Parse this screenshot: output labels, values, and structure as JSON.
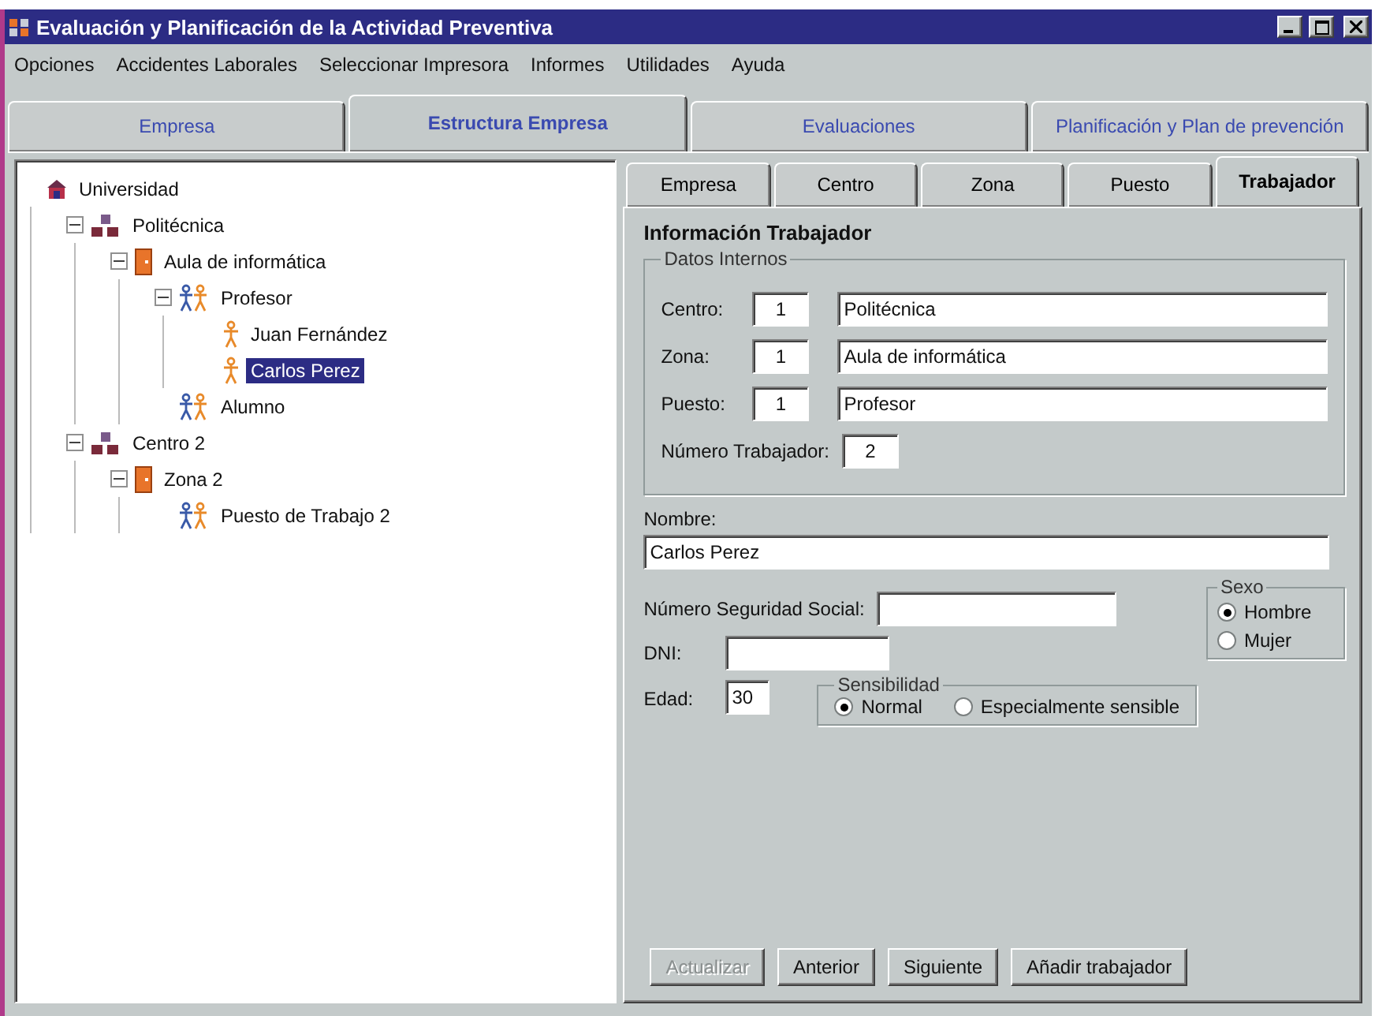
{
  "window": {
    "title": "Evaluación y Planificación de la Actividad Preventiva"
  },
  "menu": [
    "Opciones",
    "Accidentes Laborales",
    "Seleccionar Impresora",
    "Informes",
    "Utilidades",
    "Ayuda"
  ],
  "main_tabs": [
    {
      "label": "Empresa",
      "selected": false
    },
    {
      "label": "Estructura Empresa",
      "selected": true
    },
    {
      "label": "Evaluaciones",
      "selected": false
    },
    {
      "label": "Planificación y Plan de prevención",
      "selected": false
    }
  ],
  "tree": [
    {
      "label": "Universidad",
      "kind": "empresa",
      "selected": false,
      "children": [
        {
          "label": "Politécnica",
          "kind": "centro",
          "expanded": true,
          "selected": false,
          "children": [
            {
              "label": "Aula de informática",
              "kind": "zona",
              "expanded": true,
              "selected": false,
              "children": [
                {
                  "label": "Profesor",
                  "kind": "puesto",
                  "expanded": true,
                  "selected": false,
                  "children": [
                    {
                      "label": "Juan Fernández",
                      "kind": "trabajador",
                      "selected": false
                    },
                    {
                      "label": "Carlos Perez",
                      "kind": "trabajador",
                      "selected": true
                    }
                  ]
                },
                {
                  "label": "Alumno",
                  "kind": "puesto",
                  "selected": false
                }
              ]
            }
          ]
        },
        {
          "label": "Centro 2",
          "kind": "centro",
          "expanded": true,
          "selected": false,
          "children": [
            {
              "label": "Zona 2",
              "kind": "zona",
              "expanded": true,
              "selected": false,
              "children": [
                {
                  "label": "Puesto de Trabajo 2",
                  "kind": "puesto",
                  "selected": false
                }
              ]
            }
          ]
        }
      ]
    }
  ],
  "detail_tabs": [
    {
      "label": "Empresa",
      "selected": false
    },
    {
      "label": "Centro",
      "selected": false
    },
    {
      "label": "Zona",
      "selected": false
    },
    {
      "label": "Puesto",
      "selected": false
    },
    {
      "label": "Trabajador",
      "selected": true
    }
  ],
  "form": {
    "title": "Información Trabajador",
    "group": "Datos Internos",
    "rows": [
      {
        "label": "Centro:",
        "code": "1",
        "name": "Politécnica"
      },
      {
        "label": "Zona:",
        "code": "1",
        "name": "Aula de informática"
      },
      {
        "label": "Puesto:",
        "code": "1",
        "name": "Profesor"
      }
    ],
    "number_label": "Número Trabajador:",
    "number_value": "2",
    "name_label": "Nombre:",
    "name_value": "Carlos Perez",
    "nss_label": "Número Seguridad Social:",
    "dni_label": "DNI:",
    "age_label": "Edad:",
    "age_value": "30",
    "sexo": {
      "title": "Sexo",
      "options": [
        {
          "label": "Hombre",
          "selected": true
        },
        {
          "label": "Mujer",
          "selected": false
        }
      ]
    },
    "sensibilidad": {
      "title": "Sensibilidad",
      "options": [
        {
          "label": "Normal",
          "selected": true
        },
        {
          "label": "Especialmente sensible",
          "selected": false
        }
      ]
    },
    "buttons": [
      {
        "label": "Actualizar",
        "disabled": true
      },
      {
        "label": "Anterior",
        "disabled": false
      },
      {
        "label": "Siguiente",
        "disabled": false
      },
      {
        "label": "Añadir trabajador",
        "disabled": false
      }
    ]
  }
}
